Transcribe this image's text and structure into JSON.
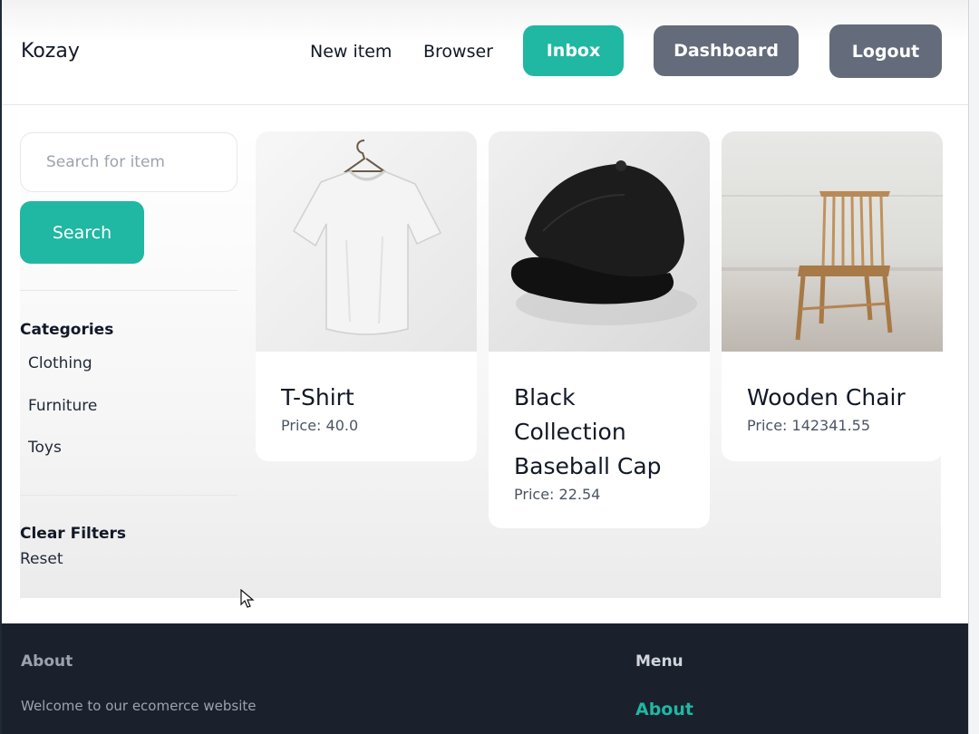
{
  "header": {
    "brand": "Kozay",
    "nav_new_item": "New item",
    "nav_browser": "Browser",
    "btn_inbox": "Inbox",
    "btn_dashboard": "Dashboard",
    "btn_logout": "Logout"
  },
  "sidebar": {
    "search_placeholder": "Search for item",
    "search_button": "Search",
    "categories_title": "Categories",
    "categories": [
      "Clothing",
      "Furniture",
      "Toys"
    ],
    "clear_filters_title": "Clear Filters",
    "reset_label": "Reset"
  },
  "items": [
    {
      "name": "T-Shirt",
      "price": "Price: 40.0"
    },
    {
      "name": "Black Collection Baseball Cap",
      "price": "Price: 22.54"
    },
    {
      "name": "Wooden Chair",
      "price": "Price: 142341.55"
    }
  ],
  "footer": {
    "about_title": "About",
    "about_text": "Welcome to our ecomerce website",
    "menu_title": "Menu",
    "menu_about": "About"
  },
  "colors": {
    "accent": "#20b7a3",
    "secondary_button": "#646b7b",
    "footer_bg": "#1a202c"
  }
}
